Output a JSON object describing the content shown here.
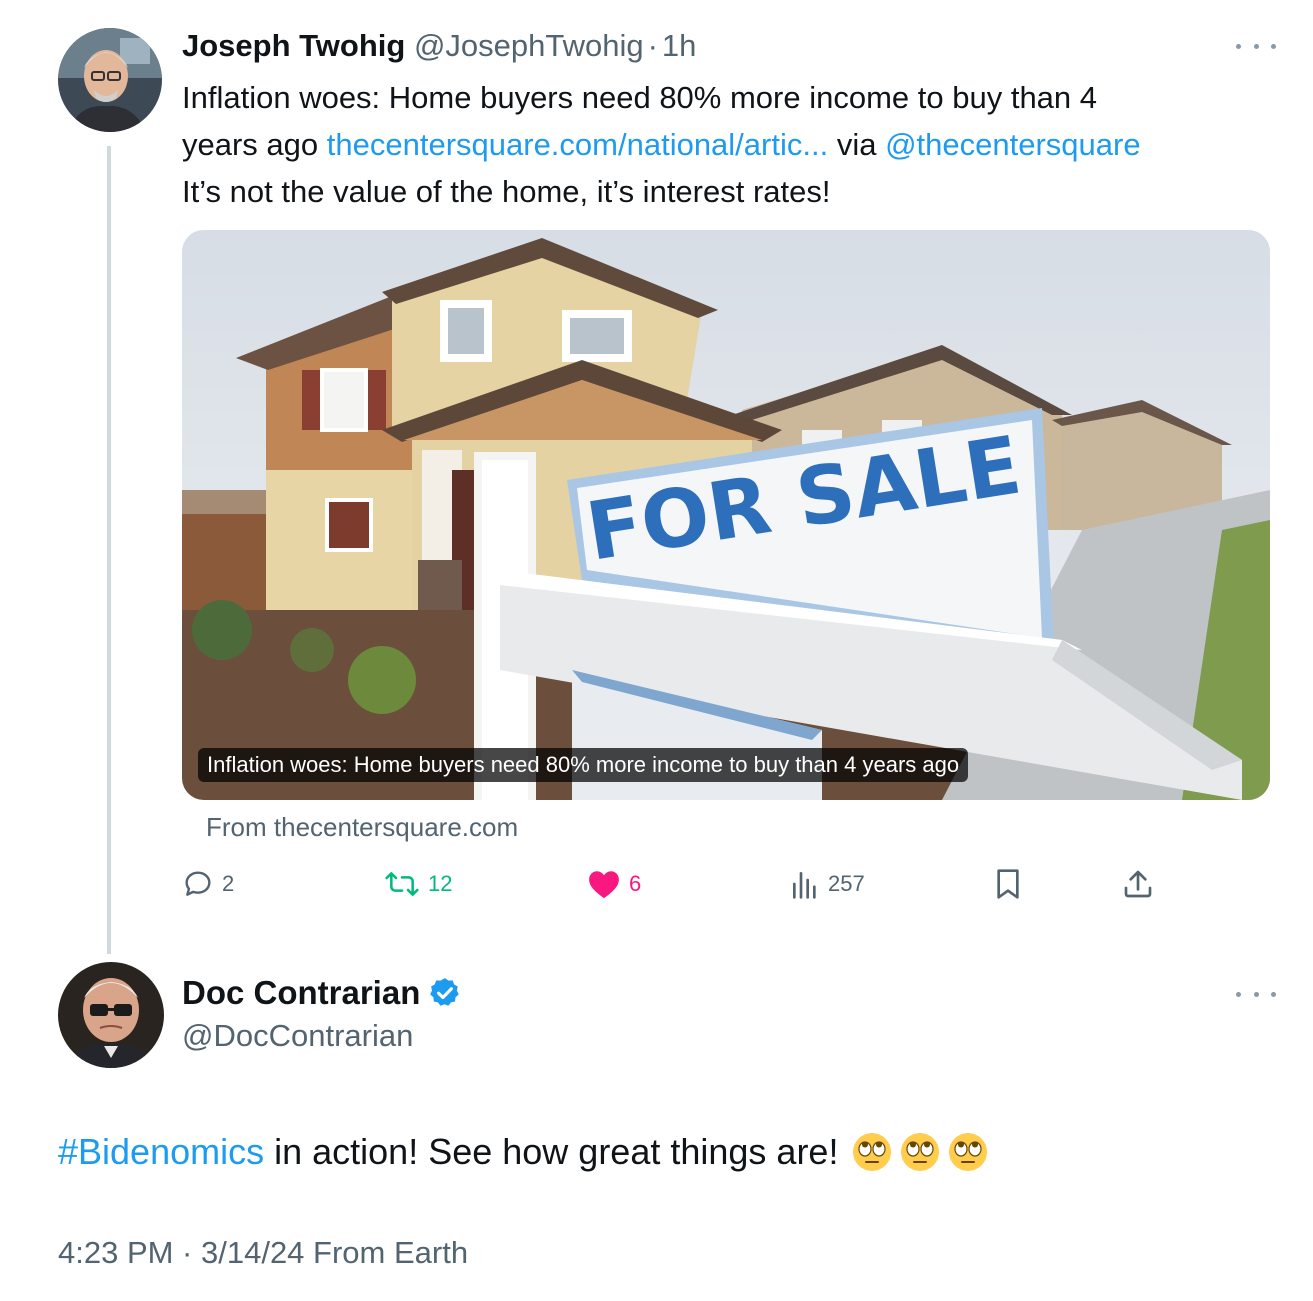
{
  "quoted_tweet": {
    "author_name": "Joseph Twohig",
    "author_handle": "@JosephTwohig",
    "separator": "·",
    "time_ago": "1h",
    "text_line1": "Inflation woes: Home buyers need 80% more income to buy than 4",
    "text_line2_prefix": "years ago ",
    "link_text": "thecentersquare.com/national/artic...",
    "via_text": " via ",
    "mention": "@thecentersquare",
    "text_line3": "It’s not the value of the home, it’s interest rates!",
    "card": {
      "sign_text": "FOR SALE",
      "caption": "Inflation woes: Home buyers need 80% more income to buy than 4 years ago",
      "source": "From thecentersquare.com"
    },
    "actions": {
      "replies": "2",
      "reposts": "12",
      "likes": "6",
      "views": "257"
    }
  },
  "main_tweet": {
    "author_name": "Doc Contrarian",
    "author_handle": "@DocContrarian",
    "hashtag": "#Bidenomics",
    "text": " in action! See how great things are!",
    "emoji_count": 3,
    "timestamp": "4:23 PM · 3/14/24 From Earth"
  },
  "colors": {
    "link": "#1d9bf0",
    "secondary_text": "#536471",
    "repost": "#00ba7c",
    "like": "#f91880",
    "verified": "#1d9bf0"
  },
  "icons": [
    "reply-icon",
    "repost-icon",
    "like-icon",
    "views-icon",
    "bookmark-icon",
    "share-icon",
    "more-icon",
    "verified-badge-icon",
    "eye-roll-emoji"
  ]
}
